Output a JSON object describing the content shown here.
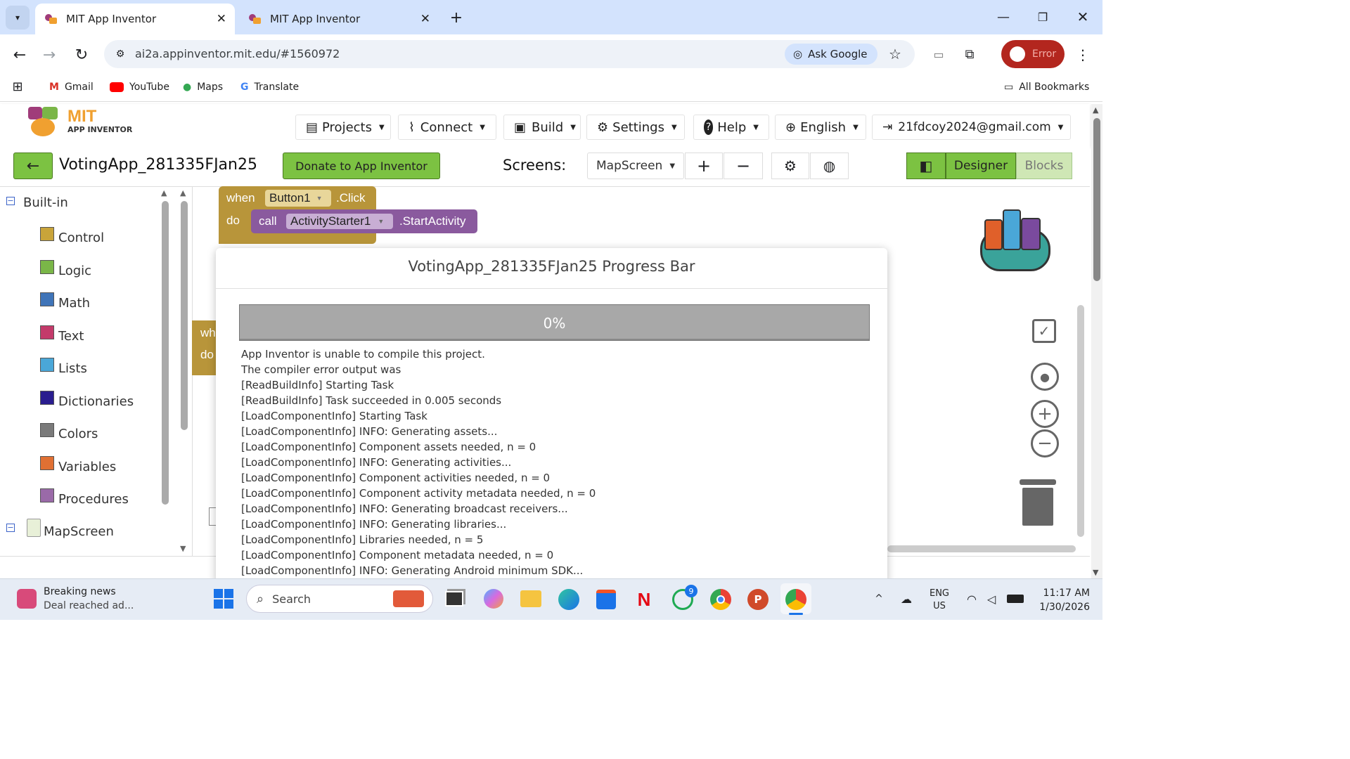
{
  "browser": {
    "tabs": [
      {
        "title": "MIT App Inventor",
        "active": true
      },
      {
        "title": "MIT App Inventor",
        "active": false
      }
    ],
    "url": "ai2a.appinventor.mit.edu/#1560972",
    "ask_google": "Ask Google",
    "profile_status": "Error",
    "bookmarks": [
      "Gmail",
      "YouTube",
      "Maps",
      "Translate"
    ],
    "all_bookmarks": "All Bookmarks"
  },
  "app": {
    "logo_mit": "MIT",
    "logo_sub": "APP INVENTOR",
    "menu": {
      "projects": "Projects",
      "connect": "Connect",
      "build": "Build",
      "settings": "Settings",
      "help": "Help",
      "language": "English",
      "account": "21fdcoy2024@gmail.com"
    },
    "project_name": "VotingApp_281335FJan25",
    "donate": "Donate to App Inventor",
    "screens_label": "Screens:",
    "screen_selected": "MapScreen",
    "designer": "Designer",
    "blocks": "Blocks"
  },
  "palette": {
    "builtin": "Built-in",
    "categories": [
      {
        "label": "Control",
        "color": "#c9a43a"
      },
      {
        "label": "Logic",
        "color": "#7ab648"
      },
      {
        "label": "Math",
        "color": "#3f74b8"
      },
      {
        "label": "Text",
        "color": "#c33a6a"
      },
      {
        "label": "Lists",
        "color": "#4aa7d8"
      },
      {
        "label": "Dictionaries",
        "color": "#2a1d8f"
      },
      {
        "label": "Colors",
        "color": "#7a7a7a"
      },
      {
        "label": "Variables",
        "color": "#e07033"
      },
      {
        "label": "Procedures",
        "color": "#9a6aa8"
      }
    ],
    "screen_node": "MapScreen"
  },
  "blocks": {
    "when": "when",
    "component": "Button1",
    "event": ".Click",
    "do": "do",
    "call": "call",
    "target": "ActivityStarter1",
    "method": ".StartActivity",
    "partial_when": "wh",
    "partial_do": "do"
  },
  "dialog": {
    "title": "VotingApp_281335FJan25 Progress Bar",
    "progress_text": "0%",
    "progress_value": 0,
    "log": [
      "App Inventor is unable to compile this project.",
      "The compiler error output was",
      "[ReadBuildInfo] Starting Task",
      "[ReadBuildInfo] Task succeeded in 0.005 seconds",
      "[LoadComponentInfo] Starting Task",
      "[LoadComponentInfo] INFO: Generating assets...",
      "[LoadComponentInfo] Component assets needed, n = 0",
      "[LoadComponentInfo] INFO: Generating activities...",
      "[LoadComponentInfo] Component activities needed, n = 0",
      "[LoadComponentInfo] Component activity metadata needed, n = 0",
      "[LoadComponentInfo] INFO: Generating broadcast receivers...",
      "[LoadComponentInfo] INFO: Generating libraries...",
      "[LoadComponentInfo] Libraries needed, n = 5",
      "[LoadComponentInfo] Component metadata needed, n = 0",
      "[LoadComponentInfo] INFO: Generating Android minimum SDK..."
    ]
  },
  "taskbar": {
    "news_title": "Breaking news",
    "news_sub": "Deal reached ad...",
    "search": "Search",
    "whatsapp_badge": "9",
    "lang_top": "ENG",
    "lang_bottom": "US",
    "time": "11:17 AM",
    "date": "1/30/2026"
  }
}
